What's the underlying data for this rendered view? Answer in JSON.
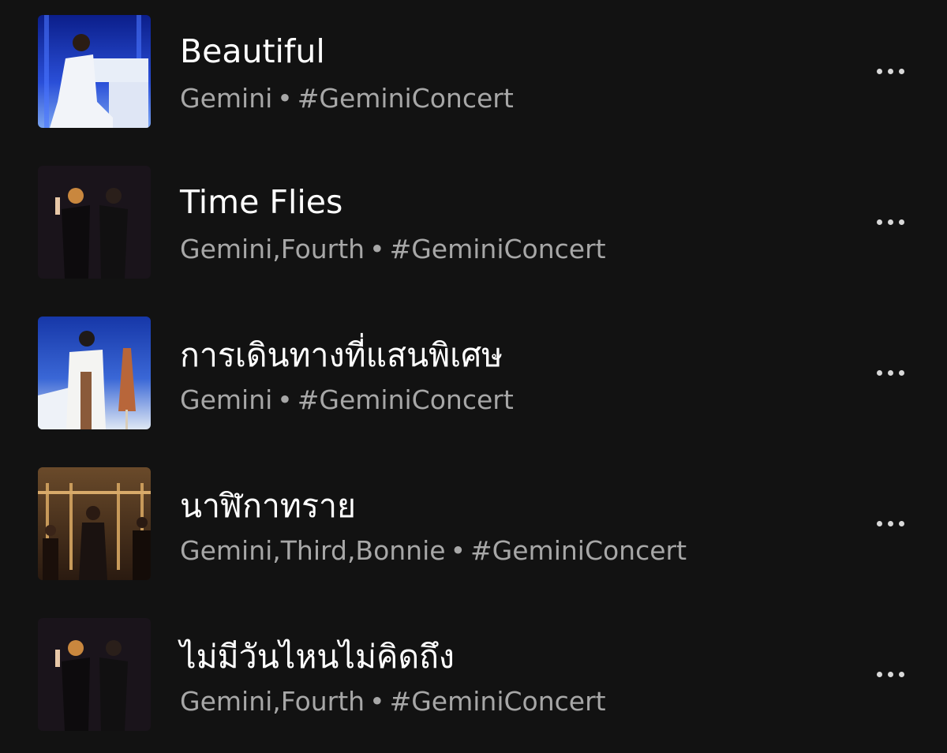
{
  "tracks": [
    {
      "title": "Beautiful",
      "artists": "Gemini",
      "separator": "•",
      "tag": "#GeminiConcert",
      "cover_icon": "album-cover-image"
    },
    {
      "title": "Time Flies",
      "artists": "Gemini,Fourth",
      "separator": "•",
      "tag": "#GeminiConcert",
      "cover_icon": "album-cover-image"
    },
    {
      "title": "การเดินทางที่แสนพิเศษ",
      "artists": "Gemini",
      "separator": "•",
      "tag": "#GeminiConcert",
      "cover_icon": "album-cover-image"
    },
    {
      "title": "นาฬิกาทราย",
      "artists": "Gemini,Third,Bonnie",
      "separator": "•",
      "tag": "#GeminiConcert",
      "cover_icon": "album-cover-image"
    },
    {
      "title": "ไม่มีวันไหนไม่คิดถึง",
      "artists": "Gemini,Fourth",
      "separator": "•",
      "tag": "#GeminiConcert",
      "cover_icon": "album-cover-image"
    }
  ],
  "more_icon": "more-options-icon",
  "colors": {
    "background": "#121212",
    "title": "#ffffff",
    "subtitle": "#a7a7a7"
  }
}
